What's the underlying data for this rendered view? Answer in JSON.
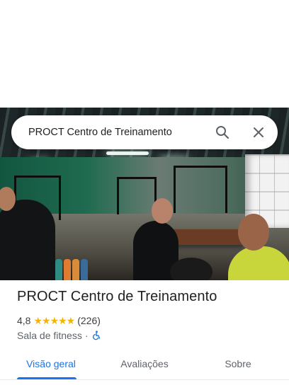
{
  "search": {
    "query": "PROCT Centro de Treinamento"
  },
  "place": {
    "name": "PROCT Centro de Treinamento",
    "rating": "4,8",
    "stars": "★★★★★",
    "review_count": "(226)",
    "category": "Sala de fitness",
    "separator": "·"
  },
  "tabs": [
    {
      "label": "Visão geral",
      "active": true
    },
    {
      "label": "Avaliações",
      "active": false
    },
    {
      "label": "Sobre",
      "active": false
    }
  ],
  "colors": {
    "accent": "#1a73e8",
    "star": "#f5b400",
    "text_primary": "#202124",
    "text_secondary": "#5f6368"
  },
  "icons": {
    "search": "search-icon",
    "close": "close-icon",
    "accessibility": "wheelchair-icon"
  }
}
